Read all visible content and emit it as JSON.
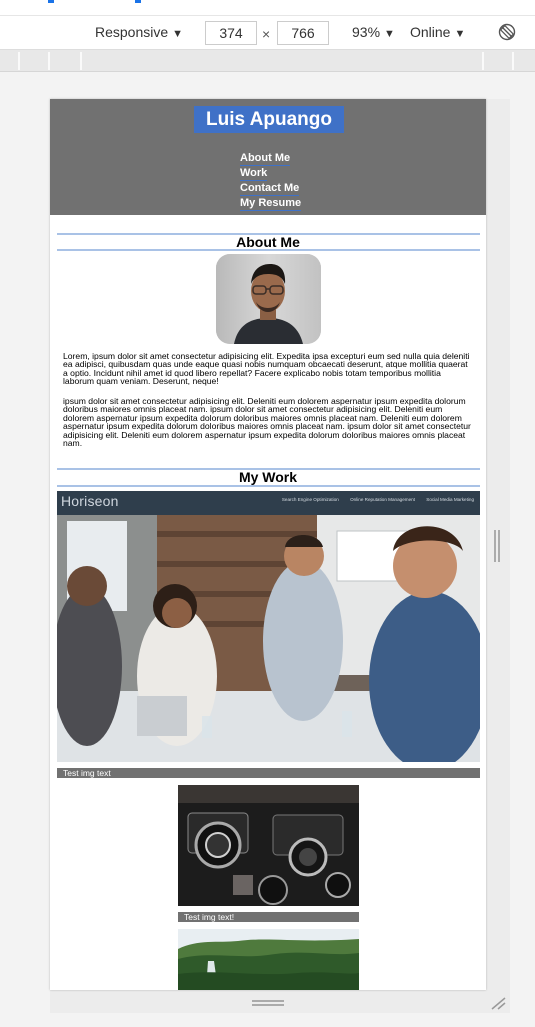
{
  "devtools": {
    "device_mode": "Responsive",
    "width_value": "374",
    "height_value": "766",
    "times_symbol": "×",
    "zoom": "93%",
    "throttle": "Online"
  },
  "site": {
    "title": "Luis Apuango",
    "nav": [
      "About Me",
      "Work",
      "Contact Me",
      "My Resume"
    ],
    "about": {
      "heading": "About Me",
      "paragraph1": "Lorem, ipsum dolor sit amet consectetur adipisicing elit. Expedita ipsa excepturi eum sed nulla quia deleniti ea adipisci, quibusdam quas unde eaque quasi nobis numquam obcaecati deserunt, atque mollitia quaerat a optio. Incidunt nihil amet id quod libero repellat? Facere explicabo nobis totam temporibus mollitia laborum quam veniam. Deserunt, neque!",
      "paragraph2": "ipsum dolor sit amet consectetur adipisicing elit. Deleniti eum dolorem aspernatur ipsum expedita dolorum doloribus maiores omnis placeat nam. ipsum dolor sit amet consectetur adipisicing elit. Deleniti eum dolorem aspernatur ipsum expedita dolorum doloribus maiores omnis placeat nam. Deleniti eum dolorem aspernatur ipsum expedita dolorum doloribus maiores omnis placeat nam. ipsum dolor sit amet consectetur adipisicing elit. Deleniti eum dolorem aspernatur ipsum expedita dolorum doloribus maiores omnis placeat nam."
    },
    "work": {
      "heading": "My Work",
      "featured": {
        "brand": "Horiseon",
        "nav_links": [
          "Search Engine Optimization",
          "Online Reputation Management",
          "Social Media Marketing"
        ],
        "caption": "Test img text"
      },
      "second": {
        "caption": "Test img text!"
      }
    }
  }
}
